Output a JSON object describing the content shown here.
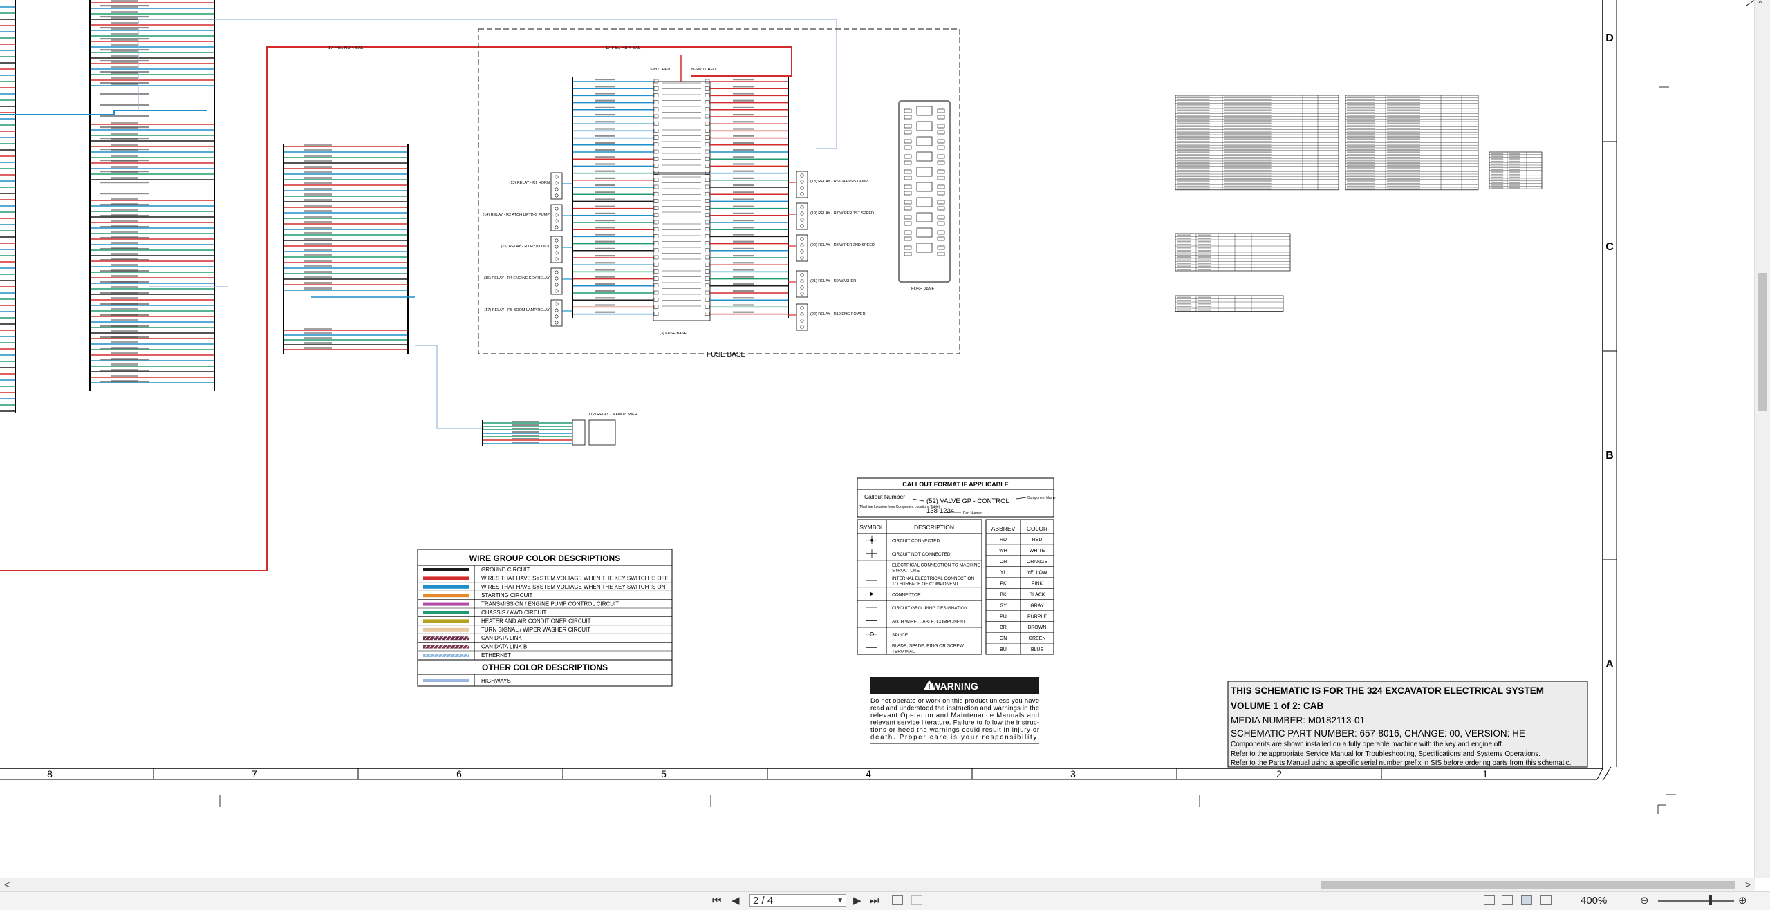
{
  "document": {
    "title_block": {
      "line1": "THIS SCHEMATIC IS FOR THE 324 EXCAVATOR ELECTRICAL SYSTEM",
      "line2": "VOLUME 1 of 2: CAB",
      "line3": "MEDIA NUMBER: M0182113-01",
      "line4": "SCHEMATIC PART NUMBER: 657-8016, CHANGE: 00, VERSION: HE",
      "line5": "Components are shown installed on a fully operable machine with the key and engine off.",
      "line6": "Refer to the appropriate Service Manual for Troubleshooting, Specifications and Systems Operations.",
      "line7": "Refer to the Parts Manual using a specific serial number prefix in SIS before ordering parts from this schematic."
    },
    "row_letters": [
      "D",
      "C",
      "B",
      "A"
    ],
    "column_numbers": [
      "8",
      "7",
      "6",
      "5",
      "4",
      "3",
      "2",
      "1"
    ],
    "fuse_base_label": "FUSE BASE",
    "fuse_panel_label": "FUSE PANEL",
    "switched_label": "SWITCHED",
    "unswitched_label": "UN-SWITCHED",
    "fuse_base_component": "(3) FUSE BASE",
    "relays_left": [
      "(13) RELAY - R1 HORN",
      "(14) RELAY - R2 ATCH LIFTING PUMP",
      "(15) RELAY - R3 HYD LOCK",
      "(16) RELAY - R4 ENGINE KEY RELAY",
      "(17) RELAY - R5 BOOM LAMP RELAY"
    ],
    "relays_right": [
      "(18) RELAY - R6 CHASSIS LAMP",
      "(19) RELAY - R7 WIPER 1ST SPEED",
      "(20) RELAY - R8 WIPER 2ND SPEED",
      "(21) RELAY - R9 WASHER",
      "(22) RELAY - R10 ENG POWER"
    ],
    "main_power_relay": "(12) RELAY - MAIN POWER",
    "wire_17f": "17-F E1 RD-4-SXL",
    "wire_group": {
      "title": "WIRE GROUP COLOR DESCRIPTIONS",
      "items": [
        {
          "color": "#1a1a1a",
          "label": "GROUND CIRCUIT",
          "pattern": "solid"
        },
        {
          "color": "#d42b2b",
          "label": "WIRES THAT HAVE SYSTEM VOLTAGE WHEN THE KEY SWITCH IS OFF",
          "pattern": "solid"
        },
        {
          "color": "#1e8fc8",
          "label": "WIRES THAT HAVE SYSTEM VOLTAGE WHEN THE KEY SWITCH IS ON",
          "pattern": "solid"
        },
        {
          "color": "#e58a2c",
          "label": "STARTING CIRCUIT",
          "pattern": "solid"
        },
        {
          "color": "#b24ba8",
          "label": "TRANSMISSION / ENGINE PUMP CONTROL CIRCUIT",
          "pattern": "solid"
        },
        {
          "color": "#1f9b6e",
          "label": "CHASSIS / AWD CIRCUIT",
          "pattern": "solid"
        },
        {
          "color": "#b7a21e",
          "label": "HEATER AND AIR CONDITIONER CIRCUIT",
          "pattern": "solid"
        },
        {
          "color": "#e6c9a1",
          "label": "TURN SIGNAL / WIPER WASHER CIRCUIT",
          "pattern": "solid"
        },
        {
          "color": "#6b2f4a",
          "label": "CAN DATA LINK",
          "pattern": "hatch"
        },
        {
          "color": "#7a3a52",
          "label": "CAN DATA LINK B",
          "pattern": "hatch"
        },
        {
          "color": "#8fb8e0",
          "label": "ETHERNET",
          "pattern": "hatch"
        }
      ],
      "other_title": "OTHER COLOR DESCRIPTIONS",
      "other_items": [
        {
          "color": "#9ab6de",
          "label": "HIGHWAYS",
          "pattern": "solid"
        }
      ]
    },
    "callout": {
      "title": "CALLOUT FORMAT IF APPLICABLE",
      "callout_number": "Callout Number",
      "callout_sub": "(Machine Location from Component Locations Table)",
      "example": "(52) VALVE GP - CONTROL",
      "part_number": "138-1234",
      "part_label": "Part Number",
      "component_label": "Component Name"
    },
    "symbols": {
      "header_symbol": "SYMBOL",
      "header_desc": "DESCRIPTION",
      "rows": [
        "CIRCUIT CONNECTED",
        "CIRCUIT NOT CONNECTED",
        "ELECTRICAL CONNECTION TO MACHINE STRUCTURE",
        "INTERNAL ELECTRICAL CONNECTION TO SURFACE OF COMPONENT",
        "CONNECTOR",
        "CIRCUIT GROUPING DESIGNATION",
        "ATCH WIRE, CABLE, COMPONENT",
        "SPLICE",
        "BLADE, SPADE, RING OR SCREW TERMINAL"
      ]
    },
    "abbrev": {
      "header_abbrev": "ABBREV",
      "header_color": "COLOR",
      "rows": [
        [
          "RD",
          "RED"
        ],
        [
          "WH",
          "WHITE"
        ],
        [
          "OR",
          "ORANGE"
        ],
        [
          "YL",
          "YELLOW"
        ],
        [
          "PK",
          "PINK"
        ],
        [
          "BK",
          "BLACK"
        ],
        [
          "GY",
          "GRAY"
        ],
        [
          "PU",
          "PURPLE"
        ],
        [
          "BR",
          "BROWN"
        ],
        [
          "GN",
          "GREEN"
        ],
        [
          "BU",
          "BLUE"
        ]
      ]
    },
    "warning": {
      "title": "WARNING",
      "lines": [
        "Do not operate or work on this product unless you have",
        "read and understood the instruction and warnings in the",
        "relevant Operation and Maintenance Manuals and",
        "relevant service literature. Failure to follow the instruc-",
        "tions or heed the warnings could result in injury or",
        "death. Proper care is your responsibility."
      ]
    }
  },
  "viewer": {
    "page_value": "2 / 4",
    "zoom_value": "400%",
    "nav_first": "⏮",
    "nav_prev": "◀",
    "nav_next": "▶",
    "nav_last": "⏭",
    "zoom_out": "⊖",
    "zoom_in": "⊕",
    "scroll_left": "<",
    "scroll_right": ">",
    "scroll_up": "^"
  },
  "colors": {
    "red": "#d42b2b",
    "blue": "#1e8fc8",
    "green": "#1f9b6e",
    "black": "#1a1a1a",
    "highway": "#9ab6de"
  }
}
